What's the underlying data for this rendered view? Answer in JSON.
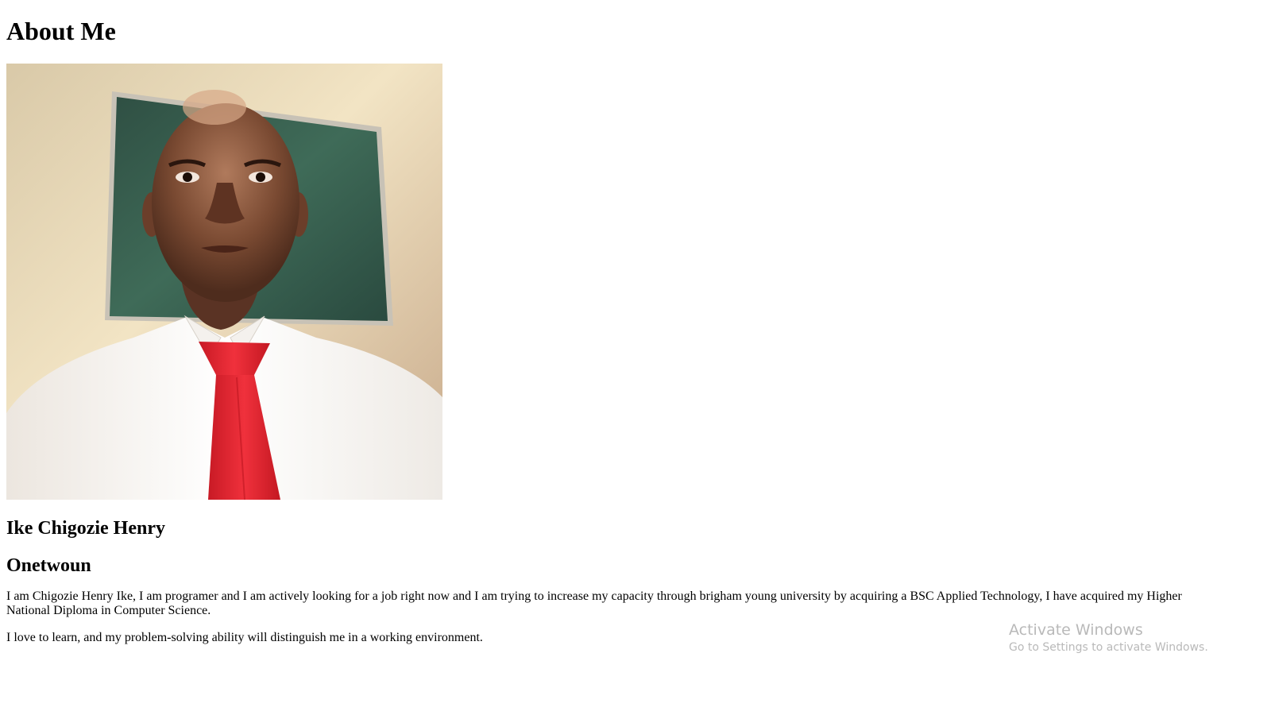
{
  "page": {
    "heading": "About Me",
    "photo_alt": "Portrait photo",
    "name": "Ike Chigozie Henry",
    "nickname": "Onetwoun",
    "paragraphs": [
      "I am Chigozie Henry Ike, I am programer and I am actively looking for a job right now and I am trying to increase my capacity through brigham young university by acquiring a BSC Applied Technology, I have acquired my Higher National Diploma in Computer Science.",
      "I love to learn, and my problem-solving ability will distinguish me in a working environment."
    ]
  },
  "watermark": {
    "title": "Activate Windows",
    "subtitle": "Go to Settings to activate Windows."
  },
  "colors": {
    "text": "#000000",
    "background": "#ffffff",
    "watermark": "#b9b9b9",
    "wall": "#e8d5b0",
    "board": "#3c5f4e",
    "shirt": "#fbf8f4",
    "tie": "#e8202c",
    "skin": "#7a4a32"
  }
}
